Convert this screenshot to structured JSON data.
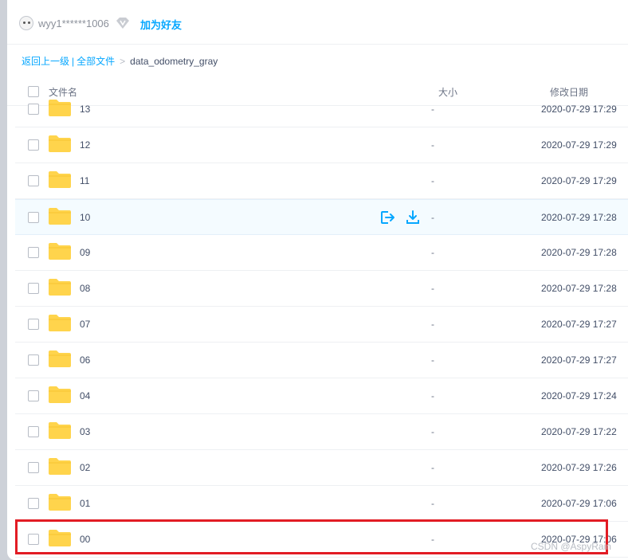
{
  "user": {
    "name": "wyy1******1006",
    "add_friend": "加为好友"
  },
  "breadcrumb": {
    "back": "返回上一级",
    "all_files": "全部文件",
    "current": "data_odometry_gray"
  },
  "table": {
    "col_name": "文件名",
    "col_size": "大小",
    "col_date": "修改日期"
  },
  "rows": [
    {
      "name": "13",
      "size": "-",
      "date": "2020-07-29 17:29"
    },
    {
      "name": "12",
      "size": "-",
      "date": "2020-07-29 17:29"
    },
    {
      "name": "11",
      "size": "-",
      "date": "2020-07-29 17:29"
    },
    {
      "name": "10",
      "size": "-",
      "date": "2020-07-29 17:28"
    },
    {
      "name": "09",
      "size": "-",
      "date": "2020-07-29 17:28"
    },
    {
      "name": "08",
      "size": "-",
      "date": "2020-07-29 17:28"
    },
    {
      "name": "07",
      "size": "-",
      "date": "2020-07-29 17:27"
    },
    {
      "name": "06",
      "size": "-",
      "date": "2020-07-29 17:27"
    },
    {
      "name": "04",
      "size": "-",
      "date": "2020-07-29 17:24"
    },
    {
      "name": "03",
      "size": "-",
      "date": "2020-07-29 17:22"
    },
    {
      "name": "02",
      "size": "-",
      "date": "2020-07-29 17:26"
    },
    {
      "name": "01",
      "size": "-",
      "date": "2020-07-29 17:06"
    },
    {
      "name": "00",
      "size": "-",
      "date": "2020-07-29 17:06"
    }
  ],
  "hovered_row": "10",
  "highlighted_row": "00",
  "watermark": "CSDN @AspyRain",
  "colors": {
    "accent": "#06a7ff",
    "folder": "#ffd44c",
    "highlight": "#e21c24"
  },
  "icons": [
    "vip-icon",
    "folder-icon",
    "share-icon",
    "download-icon"
  ]
}
